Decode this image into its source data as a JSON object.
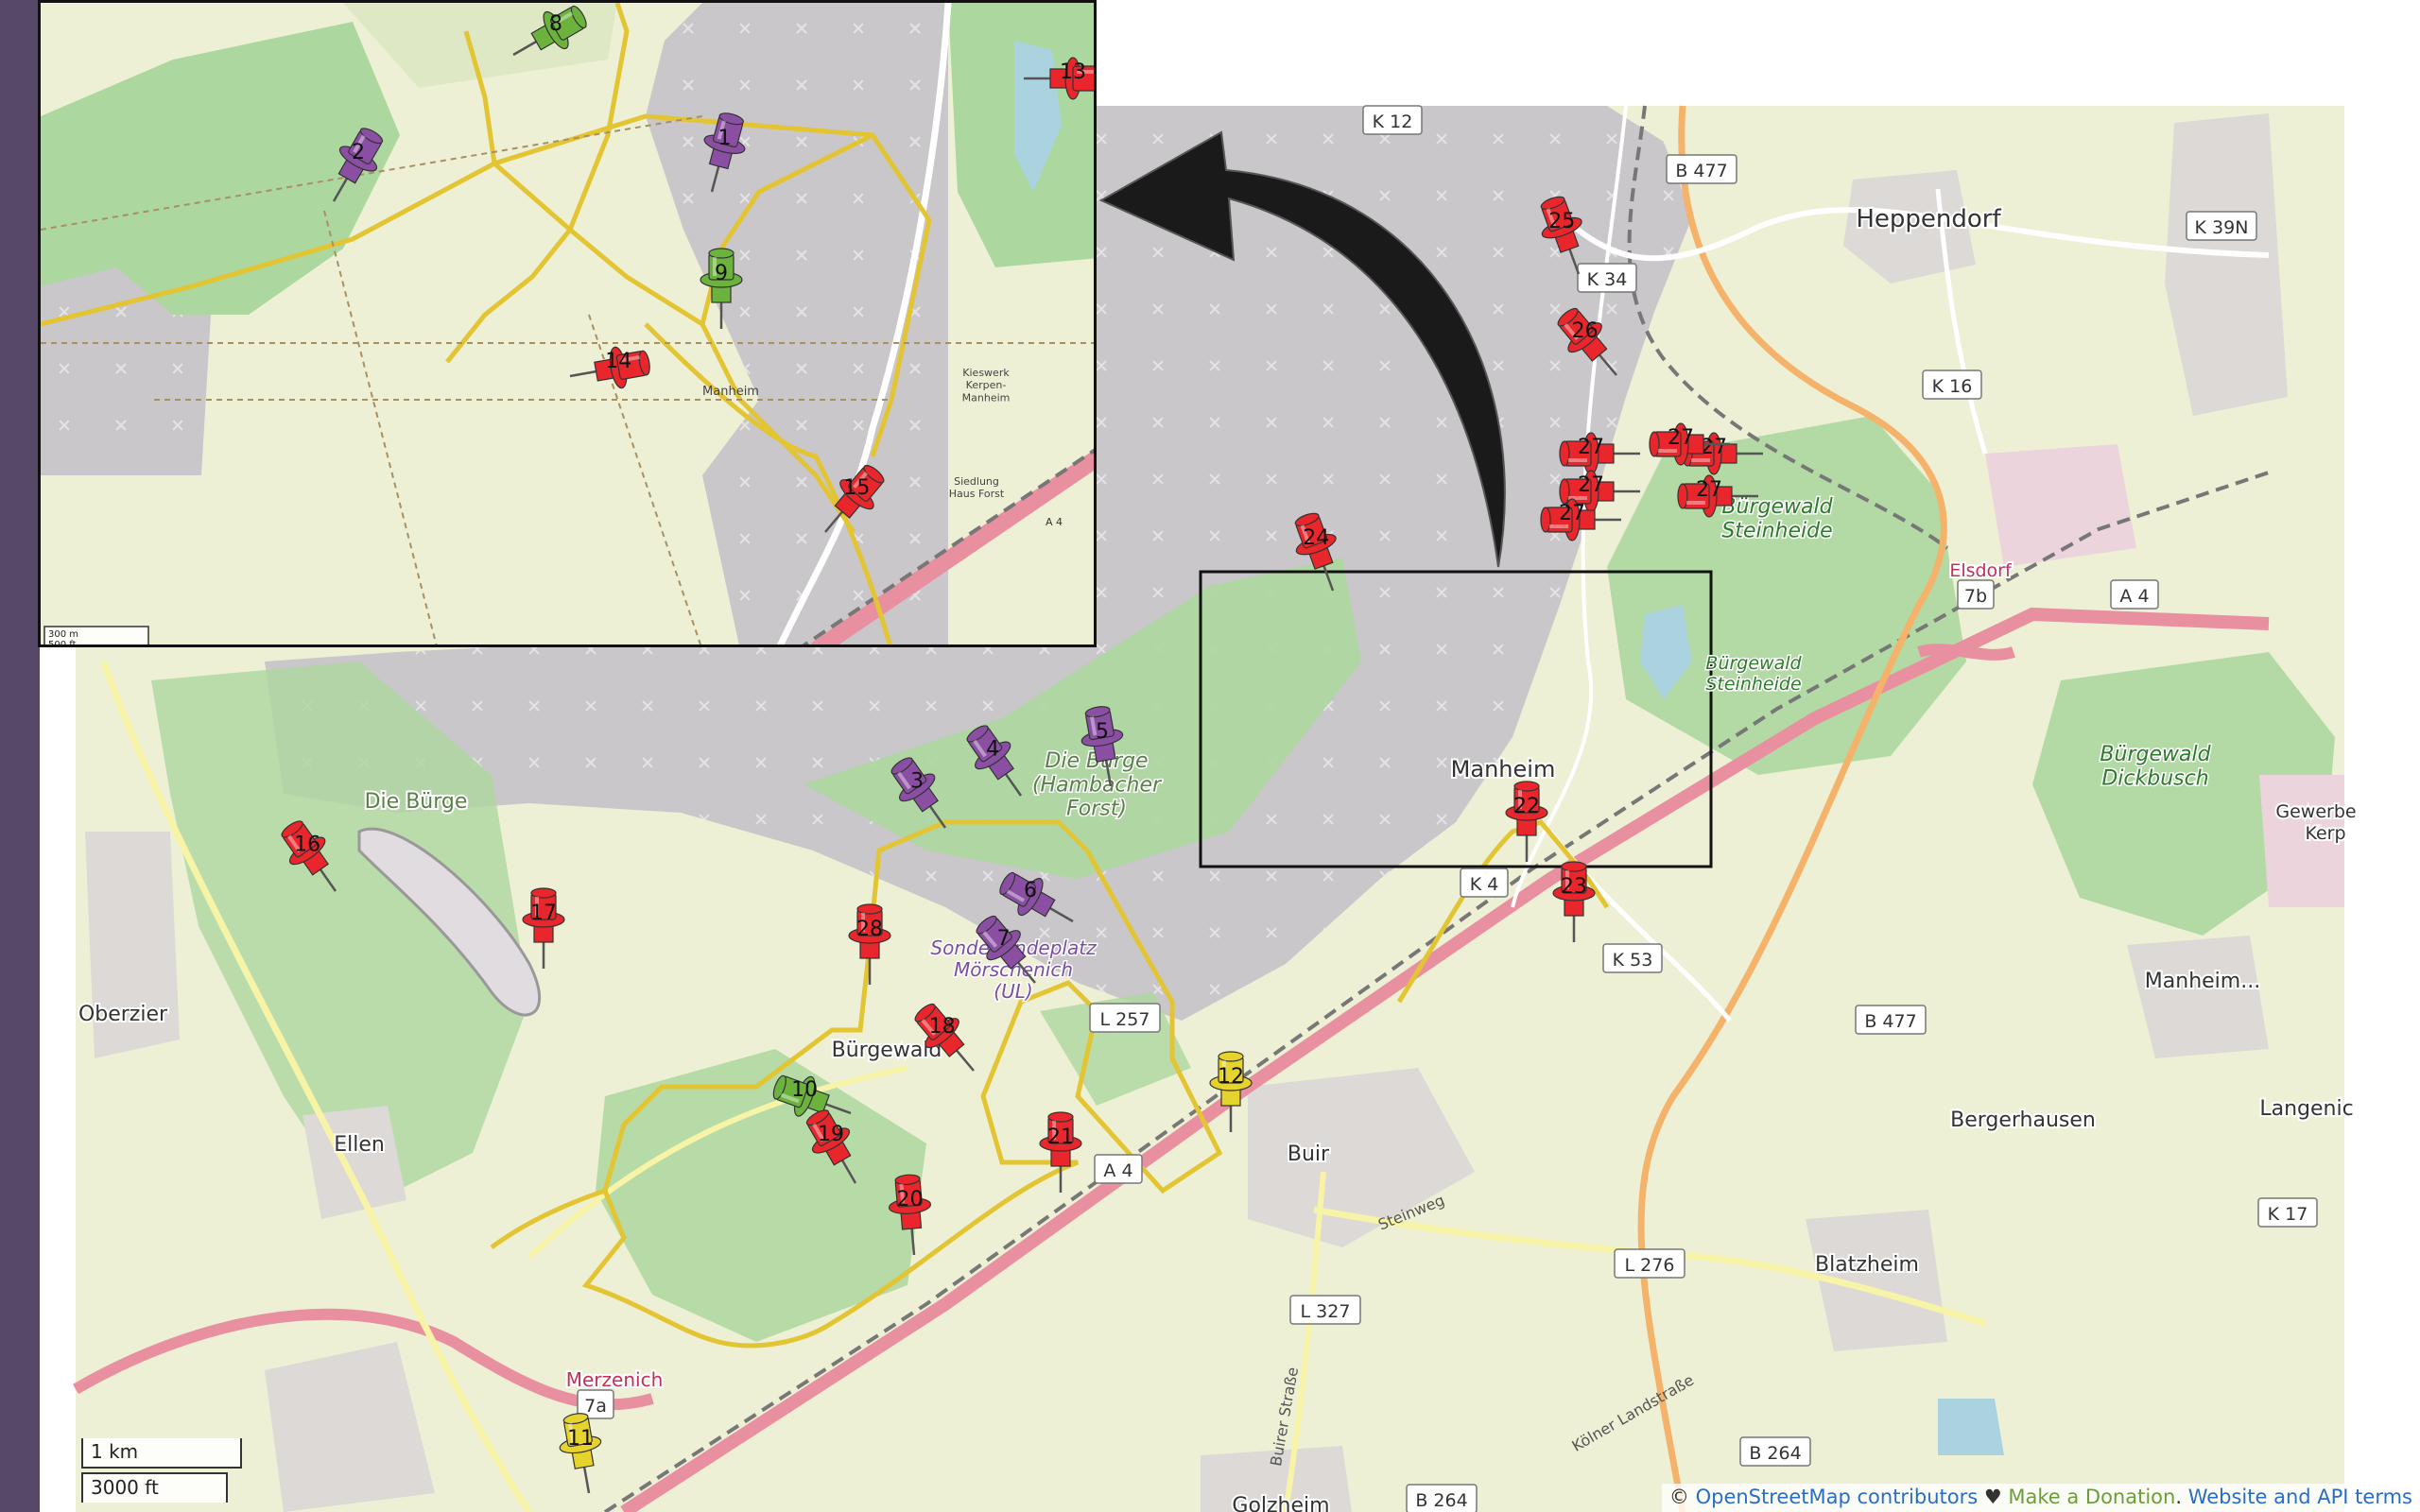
{
  "main_map": {
    "place_labels": [
      {
        "id": "heppendorf",
        "text": "Heppendorf"
      },
      {
        "id": "manheim",
        "text": "Manheim"
      },
      {
        "id": "burgewald",
        "text": "Bürgewald"
      },
      {
        "id": "ellen",
        "text": "Ellen"
      },
      {
        "id": "oberzier",
        "text": "Oberzier"
      },
      {
        "id": "buir",
        "text": "Buir"
      },
      {
        "id": "bergerhausen",
        "text": "Bergerhausen"
      },
      {
        "id": "blatzheim",
        "text": "Blatzheim"
      },
      {
        "id": "manheim-neu",
        "text": "Manheim..."
      },
      {
        "id": "langenich",
        "text": "Langenic"
      },
      {
        "id": "golzheim",
        "text": "Golzheim"
      },
      {
        "id": "gewerbe",
        "text": "Gewerbe"
      },
      {
        "id": "kerpen",
        "text": "Kerp"
      },
      {
        "id": "elsdorf",
        "text": "Elsdorf"
      },
      {
        "id": "merzenich",
        "text": "Merzenich"
      },
      {
        "id": "die-burge-west",
        "text": "Die Bürge"
      }
    ],
    "area_labels": [
      {
        "id": "burgewald-steinheide-1",
        "lines": [
          "Bürgewald",
          "Steinheide"
        ]
      },
      {
        "id": "burgewald-steinheide-2",
        "lines": [
          "Bürgewald",
          "Steinheide"
        ]
      },
      {
        "id": "burgewald-dickbusch",
        "lines": [
          "Bürgewald",
          "Dickbusch"
        ]
      },
      {
        "id": "die-burge-hambach",
        "lines": [
          "Die Bürge",
          "(Hambacher",
          "Forst)"
        ]
      },
      {
        "id": "sonderlandeplatz",
        "lines": [
          "Sonderlandeplatz",
          "Mörschenich",
          "(UL)"
        ]
      }
    ],
    "road_shields": [
      {
        "id": "k12",
        "text": "K 12"
      },
      {
        "id": "b477-north",
        "text": "B 477"
      },
      {
        "id": "k34",
        "text": "K 34"
      },
      {
        "id": "k39n",
        "text": "K 39N"
      },
      {
        "id": "k16",
        "text": "K 16"
      },
      {
        "id": "a4-east",
        "text": "A 4"
      },
      {
        "id": "k53",
        "text": "K 53"
      },
      {
        "id": "b477-south",
        "text": "B 477"
      },
      {
        "id": "l257",
        "text": "L 257"
      },
      {
        "id": "a4-west",
        "text": "A 4"
      },
      {
        "id": "l276",
        "text": "L 276"
      },
      {
        "id": "l327",
        "text": "L 327"
      },
      {
        "id": "k17",
        "text": "K 17"
      },
      {
        "id": "b264-a",
        "text": "B 264"
      },
      {
        "id": "b264-b",
        "text": "B 264"
      },
      {
        "id": "k4",
        "text": "K 4"
      },
      {
        "id": "exit-7b",
        "text": "7b"
      },
      {
        "id": "exit-7a",
        "text": "7a"
      }
    ],
    "street_labels": [
      {
        "id": "steinweg",
        "text": "Steinweg"
      },
      {
        "id": "buirer-strasse",
        "text": "Buirer Straße"
      },
      {
        "id": "kolner-landstrasse",
        "text": "Kölner Landstraße"
      }
    ],
    "pins": [
      {
        "n": "3",
        "color": "purple"
      },
      {
        "n": "4",
        "color": "purple"
      },
      {
        "n": "5",
        "color": "purple"
      },
      {
        "n": "6",
        "color": "purple"
      },
      {
        "n": "7",
        "color": "purple"
      },
      {
        "n": "10",
        "color": "green"
      },
      {
        "n": "11",
        "color": "yellow"
      },
      {
        "n": "12",
        "color": "yellow"
      },
      {
        "n": "16",
        "color": "red"
      },
      {
        "n": "17",
        "color": "red"
      },
      {
        "n": "18",
        "color": "red"
      },
      {
        "n": "19",
        "color": "red"
      },
      {
        "n": "20",
        "color": "red"
      },
      {
        "n": "21",
        "color": "red"
      },
      {
        "n": "22",
        "color": "red"
      },
      {
        "n": "23",
        "color": "red"
      },
      {
        "n": "24",
        "color": "red"
      },
      {
        "n": "25",
        "color": "red"
      },
      {
        "n": "26",
        "color": "red"
      },
      {
        "n": "27",
        "color": "red"
      },
      {
        "n": "27",
        "color": "red"
      },
      {
        "n": "27",
        "color": "red"
      },
      {
        "n": "27",
        "color": "red"
      },
      {
        "n": "27",
        "color": "red"
      },
      {
        "n": "27",
        "color": "red"
      },
      {
        "n": "28",
        "color": "red"
      }
    ],
    "scale": {
      "metric": "1 km",
      "imperial": "3000 ft"
    },
    "attribution": {
      "prefix": "© ",
      "osm": "OpenStreetMap contributors",
      "heart": " ♥ ",
      "donation": "Make a Donation",
      "sep": ". ",
      "terms": "Website and API terms"
    }
  },
  "inset_map": {
    "labels": [
      {
        "id": "manheim",
        "text": "Manheim"
      },
      {
        "id": "kieswerk",
        "lines": [
          "Kieswerk",
          "Kerpen-",
          "Manheim"
        ]
      },
      {
        "id": "siedlung",
        "lines": [
          "Siedlung",
          "Haus Forst"
        ]
      },
      {
        "id": "a4",
        "text": "A 4"
      }
    ],
    "pins": [
      {
        "n": "1",
        "color": "purple"
      },
      {
        "n": "2",
        "color": "purple"
      },
      {
        "n": "8",
        "color": "green"
      },
      {
        "n": "9",
        "color": "green"
      },
      {
        "n": "13",
        "color": "red"
      },
      {
        "n": "14",
        "color": "red"
      },
      {
        "n": "15",
        "color": "red"
      }
    ],
    "scale": {
      "metric": "300 m",
      "imperial": "500 ft"
    }
  },
  "colors": {
    "pin_red": "#e8262b",
    "pin_purple": "#8a4fa3",
    "pin_green": "#6cb33e",
    "pin_yellow": "#e6d42c",
    "farmland": "#eef0d5",
    "forest": "#acd79f",
    "mine": "#c9c7c9",
    "motorway": "#e990a0",
    "track_yellow": "#e3c432",
    "sidebar": "#574867"
  }
}
